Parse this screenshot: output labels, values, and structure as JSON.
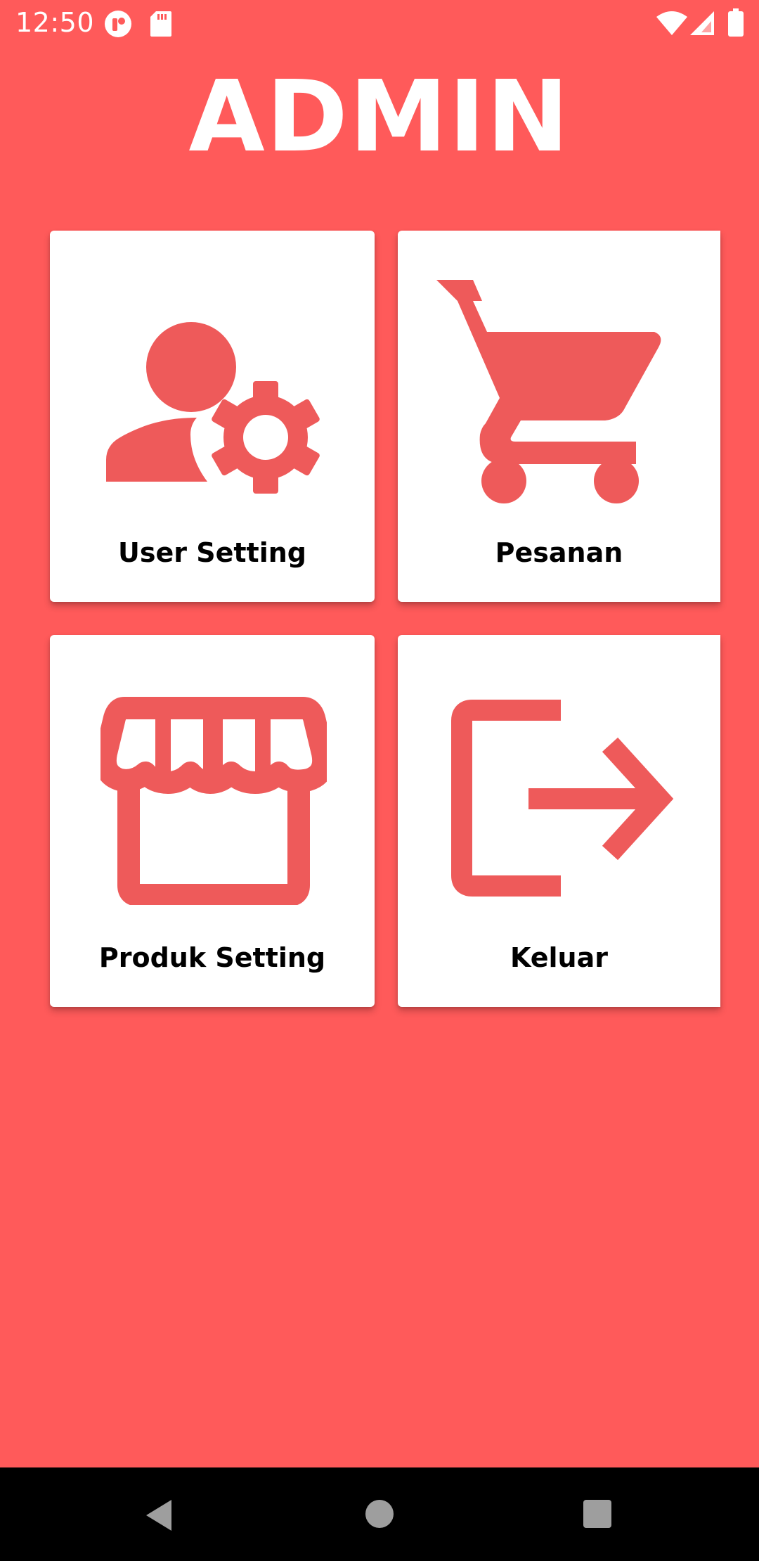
{
  "status_bar": {
    "time": "12:50",
    "left_icons": [
      "app-notification-icon",
      "sd-card-icon"
    ],
    "right_icons": [
      "wifi-icon",
      "cellular-signal-icon",
      "battery-icon"
    ]
  },
  "page": {
    "title": "ADMIN",
    "background_color": "#ff5a5a",
    "icon_color": "#ee5a5a"
  },
  "menu": [
    {
      "label": "User Setting",
      "icon": "user-settings-icon"
    },
    {
      "label": "Pesanan",
      "icon": "shopping-cart-icon"
    },
    {
      "label": "Produk Setting",
      "icon": "storefront-icon"
    },
    {
      "label": "Keluar",
      "icon": "logout-icon"
    }
  ],
  "nav_bar": {
    "buttons": [
      "back-icon",
      "home-icon",
      "recents-icon"
    ]
  }
}
